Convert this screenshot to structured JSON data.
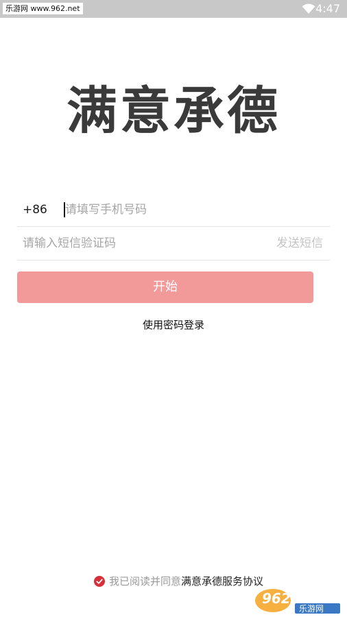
{
  "status_bar": {
    "watermark": "乐游网 www.962.net",
    "time": "4:47",
    "wifi_icon": "wifi-icon"
  },
  "app": {
    "title": "满意承德"
  },
  "login": {
    "country_code": "+86",
    "phone_placeholder": "请填写手机号码",
    "code_placeholder": "请输入短信验证码",
    "send_code_label": "发送短信",
    "start_button_label": "开始",
    "password_login_label": "使用密码登录"
  },
  "agreement": {
    "prefix": "我已阅读并同意",
    "link": "满意承德服务协议",
    "checked": true,
    "check_icon": "checkmark-circle-icon",
    "check_color": "#d8303a"
  },
  "corner_watermark": {
    "brand": "962.NET",
    "sub": "乐游网"
  },
  "colors": {
    "status_bar": "#c8c8c8",
    "button": "#f29a99",
    "title": "#3a3a3a",
    "divider": "#e3e3e3"
  }
}
